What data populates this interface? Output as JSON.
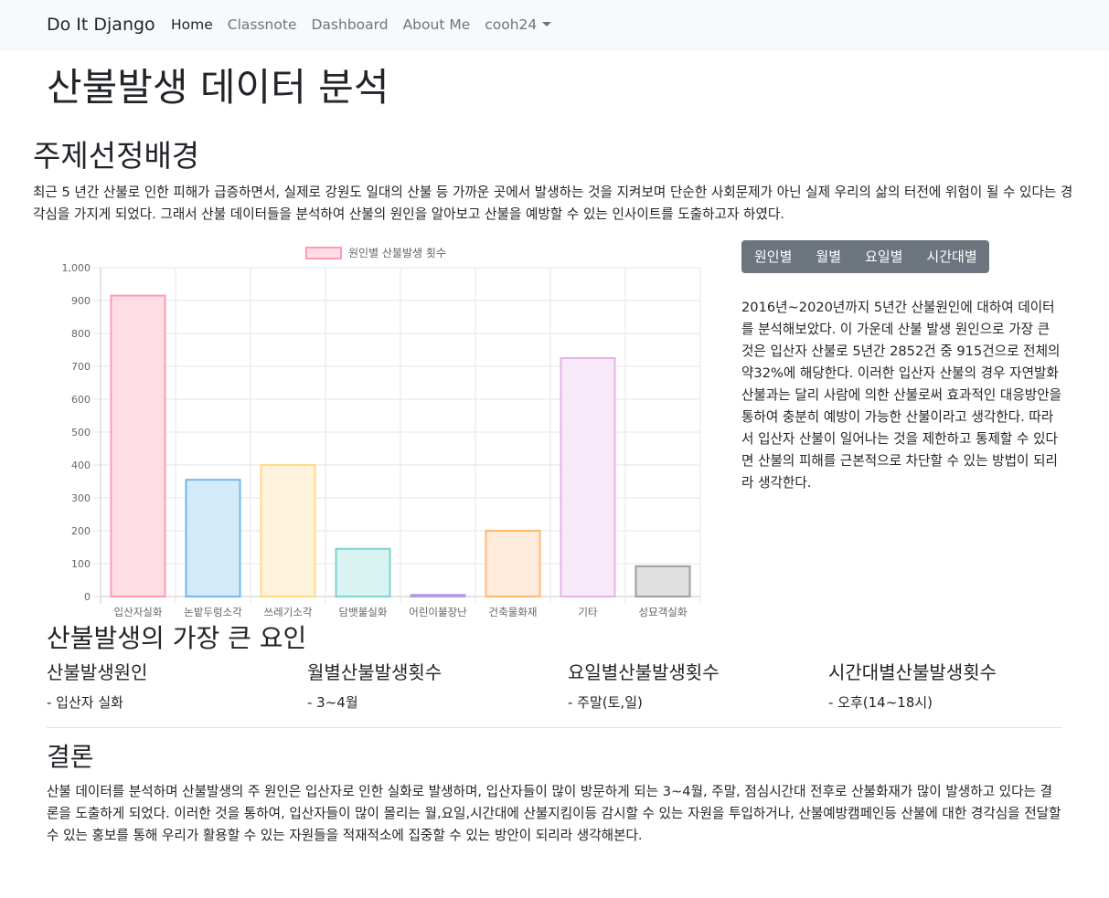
{
  "navbar": {
    "brand": "Do It Django",
    "links": [
      "Home",
      "Classnote",
      "Dashboard",
      "About Me"
    ],
    "user": "cooh24"
  },
  "page": {
    "title": "산불발생 데이터 분석",
    "background_heading": "주제선정배경",
    "background_text": "최근 5 년간 산불로 인한 피해가 급증하면서, 실제로 강원도 일대의 산불 등 가까운 곳에서 발생하는 것을 지켜보며 단순한 사회문제가 아닌 실제 우리의 삶의 터전에 위험이 될 수 있다는 경각심을 가지게 되었다. 그래서 산불 데이터들을 분석하여 산불의 원인을 알아보고 산불을 예방할 수 있는 인사이트를 도출하고자 하였다."
  },
  "tabs": [
    "원인별",
    "월별",
    "요일별",
    "시간대별"
  ],
  "description": "2016년~2020년까지 5년간 산불원인에 대하여 데이터를 분석해보았다. 이 가운데 산불 발생 원인으로 가장 큰 것은 입산자 산불로 5년간 2852건 중 915건으로 전체의 약32%에 해당한다. 이러한 입산자 산불의 경우 자연발화 산불과는 달리 사람에 의한 산불로써 효과적인 대응방안을 통하여 충분히 예방이 가능한 산불이라고 생각한다. 따라서 입산자 산불이 일어나는 것을 제한하고 통제할 수 있다면 산불의 피해를 근본적으로 차단할 수 있는 방법이 되리라 생각한다.",
  "factors": {
    "heading": "산불발생의 가장 큰 요인",
    "items": [
      {
        "title": "산불발생원인",
        "value": "- 입산자 실화"
      },
      {
        "title": "월별산불발생횟수",
        "value": "- 3~4월"
      },
      {
        "title": "요일별산불발생횟수",
        "value": "- 주말(토,일)"
      },
      {
        "title": "시간대별산불발생횟수",
        "value": "- 오후(14~18시)"
      }
    ]
  },
  "conclusion": {
    "heading": "결론",
    "text": "산불 데이터를 분석하며 산불발생의 주 원인은 입산자로 인한 실화로 발생하며, 입산자들이 많이 방문하게 되는 3~4월, 주말, 점심시간대 전후로 산불화재가 많이 발생하고 있다는 결론을 도출하게 되었다. 이러한 것을 통하여, 입산자들이 많이 몰리는 월,요일,시간대에 산불지킴이등 감시할 수 있는 자원을 투입하거나, 산불예방캠페인등 산불에 대한 경각심을 전달할 수 있는 홍보를 통해 우리가 활용할 수 있는 자원들을 적재적소에 집중할 수 있는 방안이 되리라 생각해본다."
  },
  "chart_data": {
    "type": "bar",
    "title": "",
    "xlabel": "",
    "ylabel": "",
    "categories": [
      "입산자실화",
      "논밭두렁소각",
      "쓰레기소각",
      "담뱃불실화",
      "어린이불장난",
      "건축물화재",
      "기타",
      "성묘객실화"
    ],
    "series": [
      {
        "name": "원인별 산불발생 횟수",
        "values": [
          915,
          355,
          400,
          145,
          5,
          200,
          725,
          92
        ]
      }
    ],
    "ylim": [
      0,
      1000
    ],
    "yticks": [
      "0",
      "100",
      "200",
      "300",
      "400",
      "500",
      "600",
      "700",
      "800",
      "900",
      "1,000"
    ],
    "grid": true,
    "legend": "top",
    "fill_colors": [
      "#ffdde4",
      "#d4ebfa",
      "#fff3dc",
      "#d9f3f3",
      "#ebe1ff",
      "#ffebd9",
      "#f8e9f8",
      "#e0e0e0"
    ],
    "border_colors": [
      "#ff9bb2",
      "#70b9ea",
      "#ffd98a",
      "#7fd3d3",
      "#b39ae6",
      "#ffb872",
      "#e6b3e6",
      "#9e9e9e"
    ]
  }
}
